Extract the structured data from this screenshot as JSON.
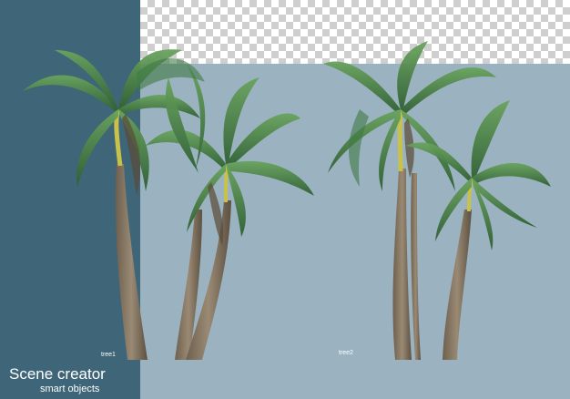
{
  "background": {
    "dark_panel_color": "#3f6578",
    "light_panel_color": "#9bb3c0",
    "transparency_pattern": "checkerboard"
  },
  "labels": {
    "tree1": "tree1",
    "tree2": "tree2"
  },
  "branding": {
    "title": "Scene creator",
    "subtitle": "smart objects"
  },
  "subjects": {
    "trunk_color": "#8a7a66",
    "frond_color": "#4f8a4a",
    "frond_dark_color": "#2f5e33"
  }
}
